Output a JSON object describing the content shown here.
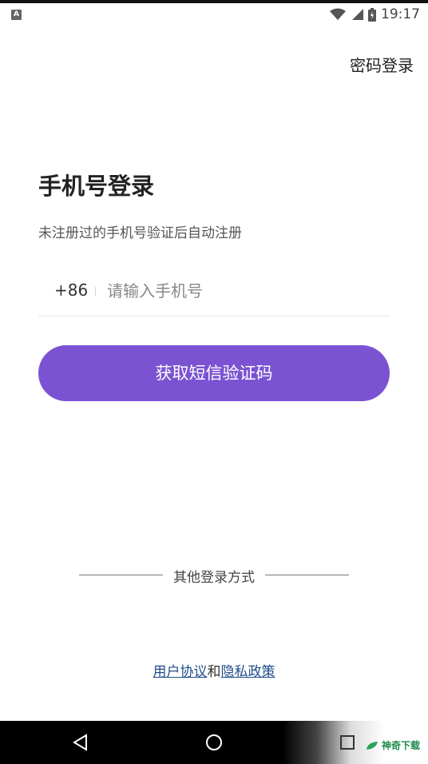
{
  "status_bar": {
    "notification_icon": "A",
    "time": "19:17",
    "icons": [
      "wifi-icon",
      "signal-icon",
      "battery-icon"
    ]
  },
  "header": {
    "password_login": "密码登录"
  },
  "login": {
    "title": "手机号登录",
    "subtitle": "未注册过的手机号验证后自动注册",
    "country_code": "+86",
    "phone_placeholder": "请输入手机号",
    "phone_value": "",
    "sms_button": "获取短信验证码"
  },
  "other_login": {
    "label": "其他登录方式"
  },
  "agreement": {
    "user_agreement": "用户协议",
    "connector": "和",
    "privacy_policy": "隐私政策"
  },
  "nav_bar": {
    "buttons": [
      "back-icon",
      "home-icon",
      "recent-apps-icon"
    ]
  },
  "watermark": {
    "text": "神奇下载"
  },
  "colors": {
    "primary": "#7b53d2",
    "link": "#1f4e8c"
  }
}
